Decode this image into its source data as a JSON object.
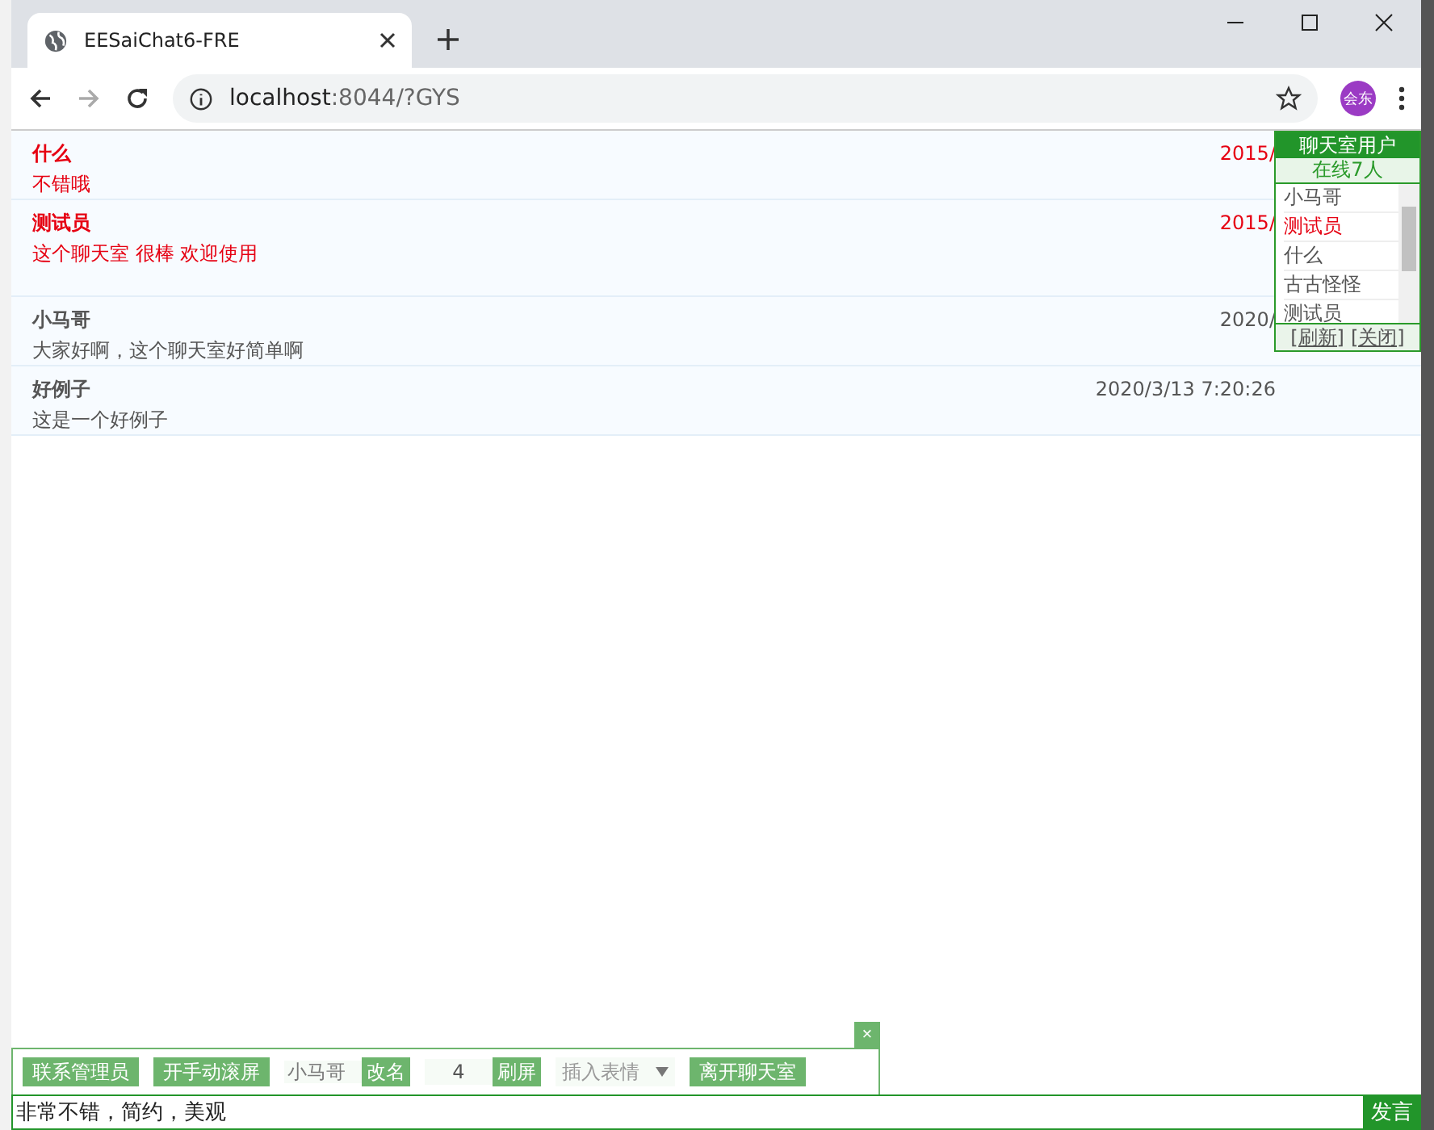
{
  "browser": {
    "tab_title": "EESaiChat6-FRE",
    "url_host": "localhost",
    "url_rest": ":8044/?GYS",
    "profile": "会东"
  },
  "messages": [
    {
      "user": "什么",
      "text": "不错哦",
      "time": "2015/",
      "color": "#e60012"
    },
    {
      "user": "测试员",
      "text": "这个聊天室 很棒 欢迎使用",
      "time": "2015/",
      "color": "#e60012"
    },
    {
      "user": "小马哥",
      "text": "大家好啊，这个聊天室好简单啊",
      "time": "2020/",
      "color": "#555555"
    },
    {
      "user": "好例子",
      "text": "这是一个好例子",
      "time": "2020/3/13 7:20:26",
      "color": "#555555"
    }
  ],
  "users_panel": {
    "title": "聊天室用户",
    "online": "在线7人",
    "users": [
      {
        "name": "小马哥",
        "color": "#555555"
      },
      {
        "name": "测试员",
        "color": "#e60012"
      },
      {
        "name": "什么",
        "color": "#555555"
      },
      {
        "name": "古古怪怪",
        "color": "#555555"
      },
      {
        "name": "测试员",
        "color": "#555555"
      }
    ],
    "refresh": "[刷新]",
    "close": "[关闭]"
  },
  "toolbar": {
    "close": "×",
    "contact_admin": "联系管理员",
    "scroll": "开手动滚屏",
    "nickname": "小马哥",
    "rename": "改名",
    "refresh_seconds": "4",
    "refresh": "刷屏",
    "emoji": "插入表情",
    "leave": "离开聊天室"
  },
  "composer": {
    "value": "非常不错，简约，美观",
    "send": "发言"
  }
}
